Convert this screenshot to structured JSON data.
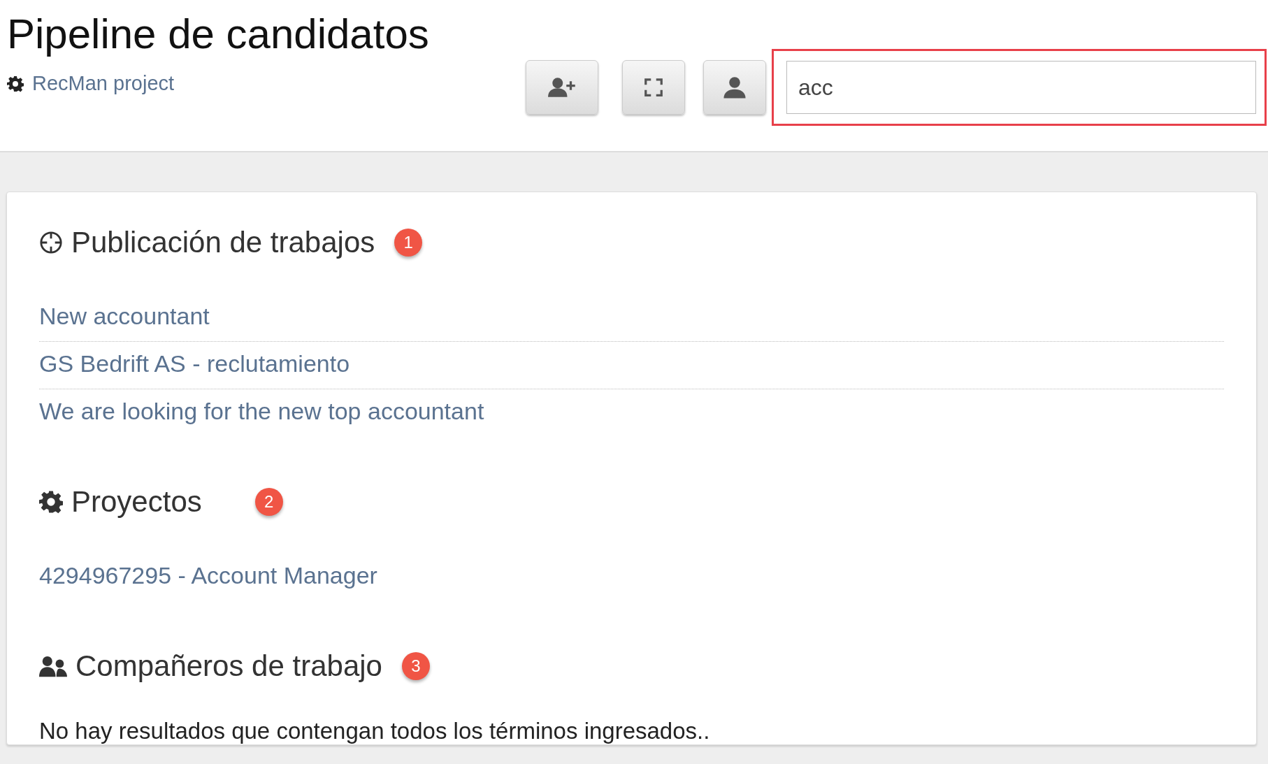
{
  "header": {
    "title": "Pipeline de candidatos",
    "project_link": "RecMan project",
    "search": {
      "value": "acc",
      "highlighted": true
    }
  },
  "sections": [
    {
      "kind": "jobs",
      "title": "Publicación de trabajos",
      "badge": "1",
      "items": [
        "New accountant",
        "GS Bedrift AS - reclutamiento",
        "We are looking for the new top accountant"
      ]
    },
    {
      "kind": "projects",
      "title": "Proyectos",
      "badge": "2",
      "items": [
        "4294967295 - Account Manager"
      ]
    },
    {
      "kind": "colleagues",
      "title": "Compañeros de trabajo",
      "badge": "3",
      "message": "No hay resultados que contengan todos los términos ingresados.."
    }
  ]
}
